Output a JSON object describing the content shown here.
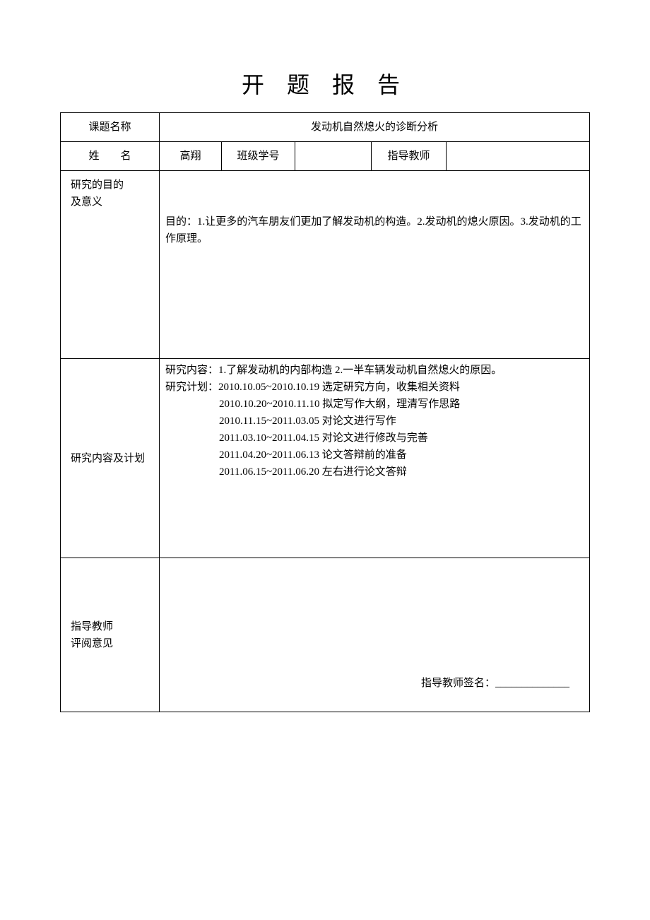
{
  "title": "开 题 报 告",
  "labels": {
    "topic_name": "课题名称",
    "name": "姓　　名",
    "class_no": "班级学号",
    "advisor": "指导教师",
    "goal": "研究的目的\n及意义",
    "plan": "研究内容及计划",
    "advisor_opinion": "指导教师\n评阅意见"
  },
  "values": {
    "topic_title": "发动机自然熄火的诊断分析",
    "student_name": "高翔",
    "class_no": "",
    "advisor": "",
    "goal_text": "目的：1.让更多的汽车朋友们更加了解发动机的构造。2.发动机的熄火原因。3.发动机的工作原理。",
    "plan_line1": "研究内容：1.了解发动机的内部构造 2.一半车辆发动机自然熄火的原因。",
    "plan_line2": "研究计划：2010.10.05~2010.10.19 选定研究方向，收集相关资料",
    "plan_line3": "2010.10.20~2010.11.10 拟定写作大纲，理清写作思路",
    "plan_line4": "2010.11.15~2011.03.05 对论文进行写作",
    "plan_line5": "2011.03.10~2011.04.15 对论文进行修改与完善",
    "plan_line6": "2011.04.20~2011.06.13 论文答辩前的准备",
    "plan_line7": "2011.06.15~2011.06.20 左右进行论文答辩",
    "signature_label": "指导教师签名：",
    "signature_line": "______________"
  }
}
